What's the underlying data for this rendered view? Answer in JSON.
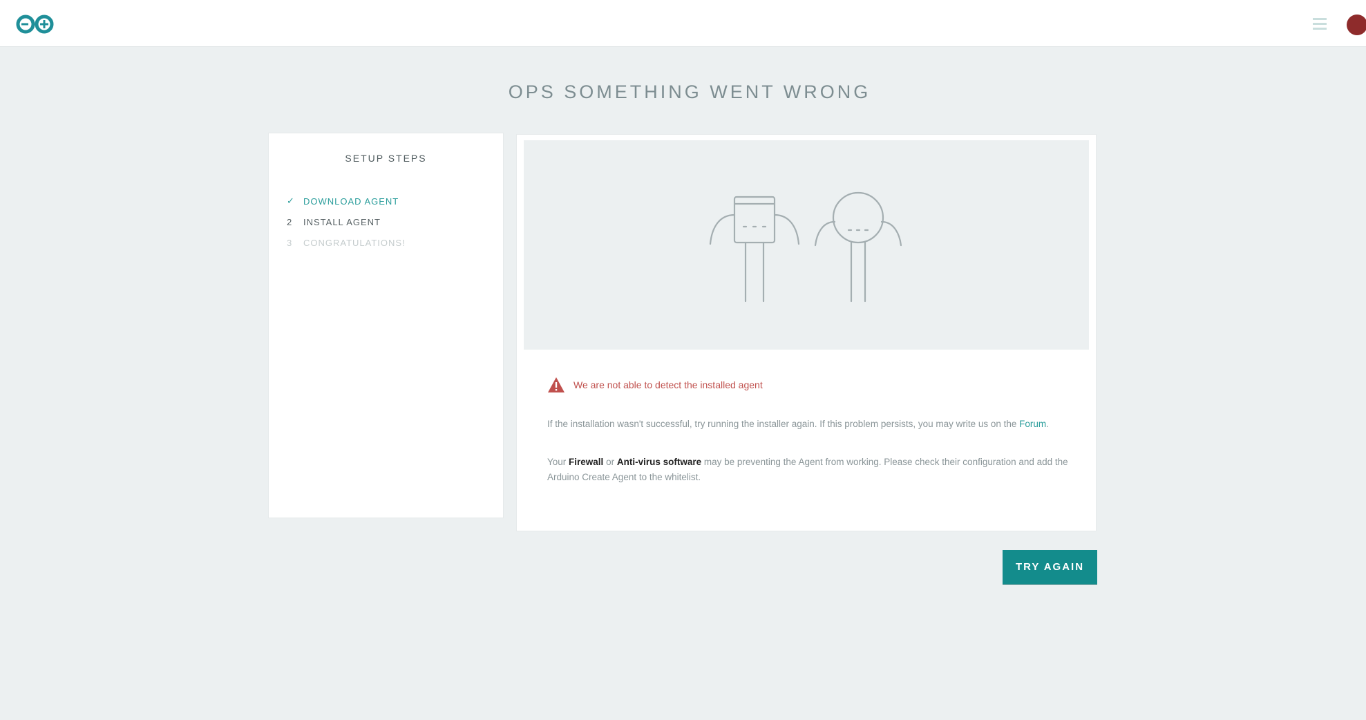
{
  "header": {
    "logo_icon": "arduino-infinity-logo",
    "menu_icon": "hamburger-menu-icon",
    "avatar_icon": "user-avatar"
  },
  "page": {
    "title": "OPS SOMETHING WENT WRONG"
  },
  "setup_steps": {
    "title": "SETUP STEPS",
    "items": [
      {
        "marker": "✓",
        "label": "DOWNLOAD AGENT",
        "state": "done"
      },
      {
        "marker": "2",
        "label": "INSTALL AGENT",
        "state": "current"
      },
      {
        "marker": "3",
        "label": "CONGRATULATIONS!",
        "state": "pending"
      }
    ]
  },
  "error_panel": {
    "illustration_icon": "two-sad-characters-illustration",
    "warning_icon": "warning-triangle-icon",
    "error_message": "We are not able to detect the installed agent",
    "paragraph_1_before": "If the installation wasn't successful, try running the installer again. If this problem persists, you may write us on the ",
    "paragraph_1_link": "Forum",
    "paragraph_1_after": ".",
    "paragraph_2_start": "Your ",
    "paragraph_2_firewall": "Firewall",
    "paragraph_2_or": " or ",
    "paragraph_2_antivirus": "Anti-virus software",
    "paragraph_2_end": " may be preventing the Agent from working. Please check their configuration and add the Arduino Create Agent to the whitelist."
  },
  "actions": {
    "try_again_label": "TRY AGAIN"
  },
  "colors": {
    "accent": "#138c8c",
    "error": "#c0504d",
    "background": "#ecf0f1"
  }
}
